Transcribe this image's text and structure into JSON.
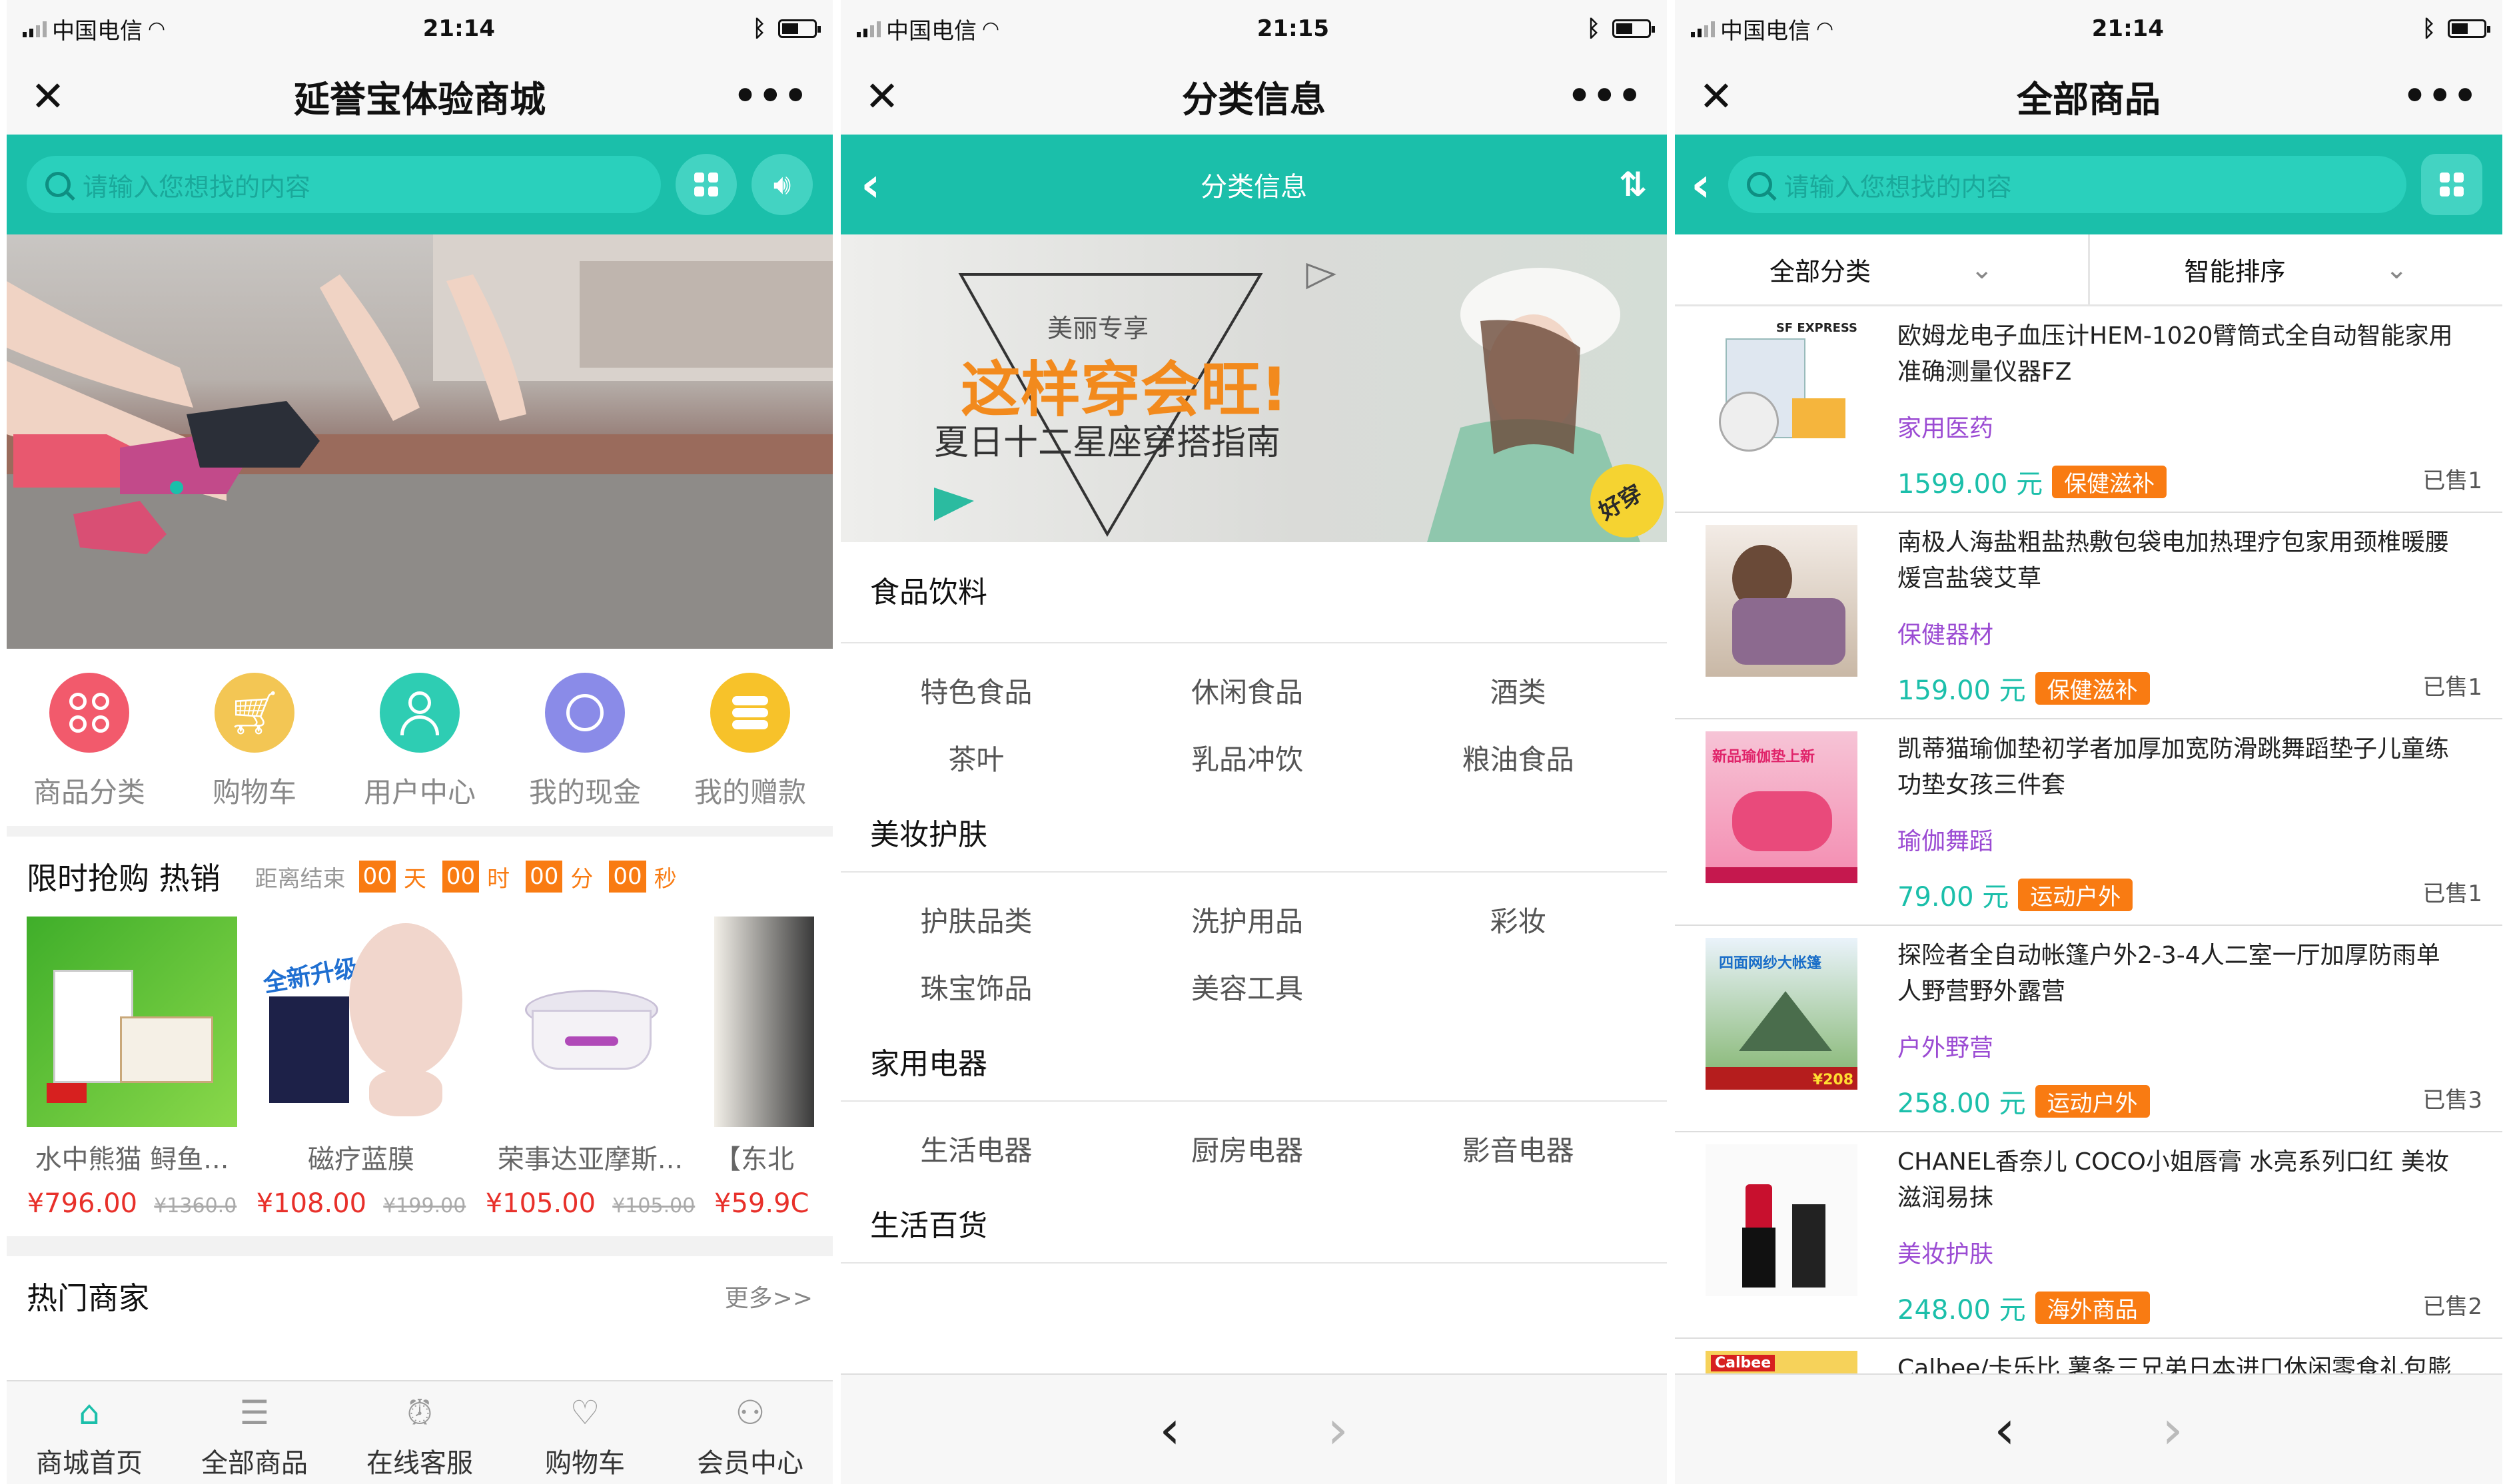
{
  "status": {
    "p1": {
      "carrier": "中国电信",
      "time": "21:14"
    },
    "p2": {
      "carrier": "中国电信",
      "time": "21:15"
    },
    "p3": {
      "carrier": "中国电信",
      "time": "21:14"
    }
  },
  "screen1": {
    "title": "延誉宝体验商城",
    "search_placeholder": "请输入您想找的内容",
    "icons": [
      {
        "label": "商品分类",
        "color": "#f25a6c"
      },
      {
        "label": "购物车",
        "color": "#f3c654"
      },
      {
        "label": "用户中心",
        "color": "#2ecdb3"
      },
      {
        "label": "我的现金",
        "color": "#8a8be8"
      },
      {
        "label": "我的赠款",
        "color": "#f7c22a"
      }
    ],
    "flash": {
      "title": "限时抢购 热销",
      "end_label": "距离结束",
      "units": [
        "天",
        "时",
        "分",
        "秒"
      ],
      "values": [
        "00",
        "00",
        "00",
        "00"
      ]
    },
    "products": [
      {
        "name": "水中熊猫 鲟鱼...",
        "price": "¥796.00",
        "old": "¥1360.0"
      },
      {
        "name": "磁疗蓝膜",
        "price": "¥108.00",
        "old": "¥199.00"
      },
      {
        "name": "荣事达亚摩斯...",
        "price": "¥105.00",
        "old": "¥105.00"
      },
      {
        "name": "【东北",
        "price": "¥59.9C",
        "old": ""
      }
    ],
    "merchants": {
      "title": "热门商家",
      "more": "更多>>"
    },
    "tabbar": [
      "商城首页",
      "全部商品",
      "在线客服",
      "购物车",
      "会员中心"
    ]
  },
  "screen2": {
    "title": "分类信息",
    "bar_title": "分类信息",
    "banner": {
      "tagline": "美丽专享",
      "headline": "这样穿会旺!",
      "sub": "夏日十二星座穿搭指南",
      "stamp": "好穿"
    },
    "sections": [
      {
        "name": "食品饮料",
        "items": [
          "特色食品",
          "休闲食品",
          "酒类",
          "茶叶",
          "乳品冲饮",
          "粮油食品"
        ]
      },
      {
        "name": "美妆护肤",
        "items": [
          "护肤品类",
          "洗护用品",
          "彩妆",
          "珠宝饰品",
          "美容工具"
        ]
      },
      {
        "name": "家用电器",
        "items": [
          "生活电器",
          "厨房电器",
          "影音电器"
        ]
      },
      {
        "name": "生活百货",
        "items": []
      }
    ]
  },
  "screen3": {
    "title": "全部商品",
    "search_placeholder": "请输入您想找的内容",
    "filters": [
      "全部分类",
      "智能排序"
    ],
    "products": [
      {
        "name": "欧姆龙电子血压计HEM-1020臂筒式全自动智能家用准确测量仪器FZ",
        "category": "家用医药",
        "price": "1599.00 元",
        "tag": "保健滋补",
        "sold": "已售1"
      },
      {
        "name": "南极人海盐粗盐热敷包袋电加热理疗包家用颈椎暖腰煖宫盐袋艾草",
        "category": "保健器材",
        "price": "159.00 元",
        "tag": "保健滋补",
        "sold": "已售1"
      },
      {
        "name": "凯蒂猫瑜伽垫初学者加厚加宽防滑跳舞蹈垫子儿童练功垫女孩三件套",
        "category": "瑜伽舞蹈",
        "price": "79.00 元",
        "tag": "运动户外",
        "sold": "已售1"
      },
      {
        "name": "探险者全自动帐篷户外2-3-4人二室一厅加厚防雨单人野营野外露营",
        "category": "户外野营",
        "price": "258.00 元",
        "tag": "运动户外",
        "sold": "已售3"
      },
      {
        "name": "CHANEL香奈儿 COCO小姐唇膏 水亮系列口红 美妆滋润易抹",
        "category": "美妆护肤",
        "price": "248.00 元",
        "tag": "海外商品",
        "sold": "已售2"
      },
      {
        "name": "Calbee/卡乐比 薯条三兄弟日本进口休闲零食礼包膨",
        "category": "",
        "price": "",
        "tag": "",
        "sold": ""
      }
    ]
  },
  "thumb_texts": {
    "sf": "SF EXPRESS",
    "mat": "新品瑜伽垫上新",
    "tent": "四面网纱大帐篷",
    "tent_price": "¥208",
    "calbee": "Calbee",
    "card_upgrade": "全新升级"
  }
}
